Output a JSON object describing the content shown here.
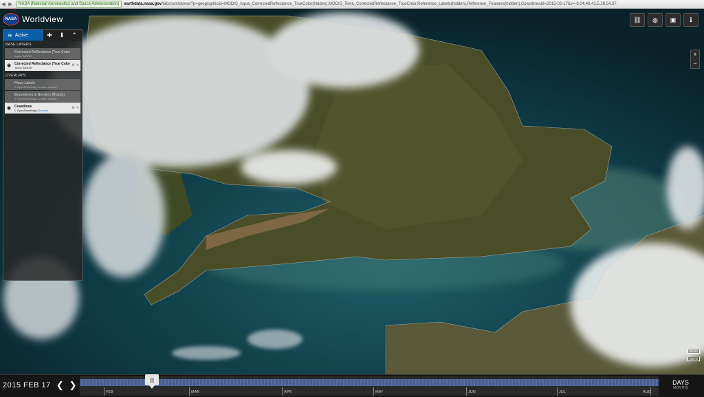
{
  "browser": {
    "secure_label": "NASA (National Aeronautics and Space Administration)",
    "host": "earthdata.nasa.gov",
    "path": "/labs/worldview/?p=geographic&l=MODIS_Aqua_CorrectedReflectance_TrueColor(hidden),MODIS_Terra_CorrectedReflectance_TrueColor,Reference_Labels(hidden),Reference_Features(hidden),Coastlines&t=2015-02-17&v=-8.04,48.42,5.28,54.37"
  },
  "app": {
    "badge": "NASA",
    "title": "Worldview"
  },
  "panel": {
    "active_tab": "Active",
    "sections": {
      "base": "Base Layers",
      "overlays": "Overlays"
    },
    "base_layers": [
      {
        "name": "Corrected Reflectance (True Color)",
        "sub": "Aqua / MODIS",
        "visible": false
      },
      {
        "name": "Corrected Reflectance (True Color)",
        "sub": "Terra / MODIS",
        "visible": true
      }
    ],
    "overlays": [
      {
        "name": "Place Labels",
        "sub": "© OpenStreetMap Contrib. Natural",
        "visible": false
      },
      {
        "name": "Boundaries & Borders (Roads)",
        "sub": "© OpenStreetMap Contrib. Natural",
        "visible": false
      },
      {
        "name": "Coastlines",
        "sub_prefix": "© OpenStreetMap ",
        "sub_link": "(Source)",
        "visible": true
      }
    ]
  },
  "icons": {
    "link": "link-icon",
    "globe": "globe-icon",
    "camera": "camera-icon",
    "info": "info-icon"
  },
  "zoom": {
    "in": "+",
    "out": "−"
  },
  "scale": {
    "top": "20 km",
    "bottom": "20 mi"
  },
  "timeline": {
    "date": "2015 FEB 17",
    "months": [
      "FEB",
      "MAR",
      "APR",
      "MAY",
      "JUN",
      "JUL",
      "AUG"
    ],
    "zoom_level": "DAYS",
    "zoom_sub": "MONTHS"
  },
  "colors": {
    "accent": "#0b5ea8",
    "panel": "#282828"
  }
}
